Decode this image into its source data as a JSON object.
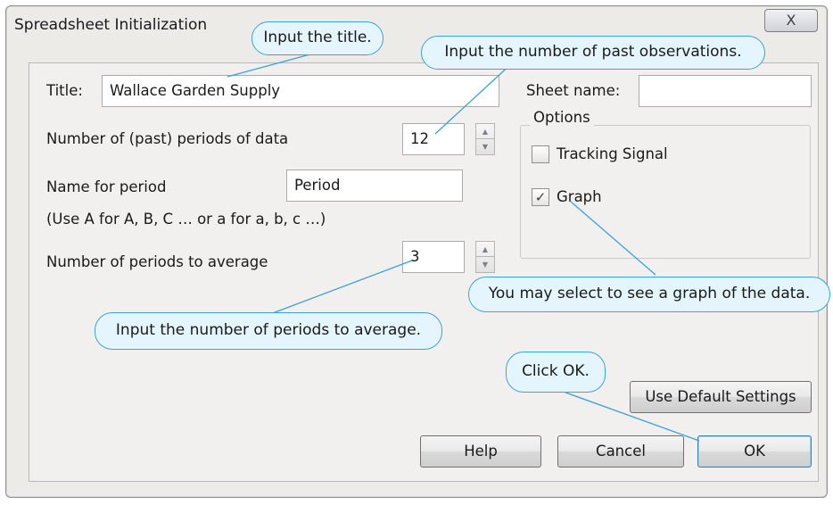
{
  "window": {
    "title": "Spreadsheet Initialization",
    "close_glyph": "X"
  },
  "form": {
    "title_label": "Title:",
    "title_value": "Wallace Garden Supply",
    "periods_label": "Number of (past) periods of data",
    "periods_value": "12",
    "period_name_label": "Name for period",
    "period_name_value": "Period",
    "hint": "(Use A for A, B, C … or a for a, b, c …)",
    "average_label": "Number of periods to average",
    "average_value": "3",
    "sheet_name_label": "Sheet name:",
    "sheet_name_value": ""
  },
  "options": {
    "title": "Options",
    "tracking_signal_label": "Tracking Signal",
    "tracking_signal_checked": false,
    "graph_label": "Graph",
    "graph_checked": true
  },
  "buttons": {
    "defaults": "Use Default Settings",
    "help": "Help",
    "cancel": "Cancel",
    "ok": "OK"
  },
  "callouts": {
    "title": "Input the title.",
    "observations": "Input the number of past observations.",
    "graph": "You may select to see a graph of the data.",
    "average": "Input the number of periods to average.",
    "ok": "Click OK."
  },
  "colors": {
    "callout_fill": "#e4f5fd",
    "callout_border": "#3aa3d9",
    "dialog_bg": "#ecebe8"
  }
}
